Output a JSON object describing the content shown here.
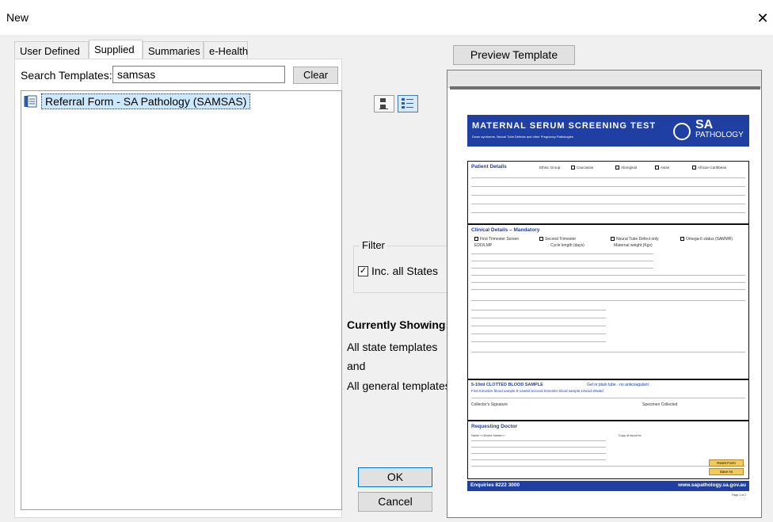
{
  "window": {
    "title": "New",
    "close_glyph": "✕"
  },
  "tabs": [
    {
      "label": "User Defined"
    },
    {
      "label": "Supplied"
    },
    {
      "label": "Summaries"
    },
    {
      "label": "e-Health"
    }
  ],
  "search": {
    "label": "Search Templates:",
    "value": "samsas",
    "clear_label": "Clear"
  },
  "templates": [
    {
      "label": "Referral Form - SA Pathology (SAMSAS)",
      "icon": "form-icon"
    }
  ],
  "view_buttons": [
    {
      "icon": "large-icons-view-icon"
    },
    {
      "icon": "details-view-icon"
    }
  ],
  "filter": {
    "label": "Filter",
    "checkbox_label": "Inc. all States",
    "checked": true
  },
  "currently": {
    "heading": "Currently Showing:",
    "line1": "All state templates",
    "line2": "and",
    "line3": "All general templates"
  },
  "buttons": {
    "ok": "OK",
    "cancel": "Cancel",
    "preview": "Preview Template"
  },
  "preview": {
    "title": "MATERNAL SERUM SCREENING TEST",
    "subtitle": "Down syndrome, Neural Tube Defects and other Pregnancy Pathologies",
    "logo_sa": "SA",
    "logo_pathology": "PATHOLOGY",
    "patient_details": "Patient Details",
    "ethnic_group": "Ethnic Group:",
    "ethnic_options": [
      "Caucasian",
      "Aboriginal",
      "Asian",
      "African-Caribbean"
    ],
    "clinical_details": "Clinical Details – Mandatory",
    "first_trimester": "First Trimester Screen",
    "second_trimester": "Second Trimester",
    "ntd_only": "Neural Tube Defect only",
    "omega": "Omega-6 status (SAMMR)",
    "edd": "EDD/LMP",
    "cycle": "Cycle length (days)",
    "weight": "Maternal weight (Kgs)",
    "clotted": "5-10ml CLOTTED BLOOD SAMPLE",
    "gel": "Gel or plain tube - no anticoagulant",
    "trimester_samples": "First trimester blood sample 9-14w0d    Second trimester blood sample 14w1d-20w6d",
    "collector": "Collector's Signature",
    "specimen": "Specimen Collected",
    "requesting_doctor": "Requesting Doctor",
    "doctor_name": "Name <<Doctor Name>>",
    "copy_report": "Copy of report to:",
    "reset": "Reset Form",
    "save": "Save As",
    "enquiries": "Enquiries 8222 3000",
    "website": "www.sapathology.sa.gov.au",
    "page_no": "Page 1 of 2"
  }
}
